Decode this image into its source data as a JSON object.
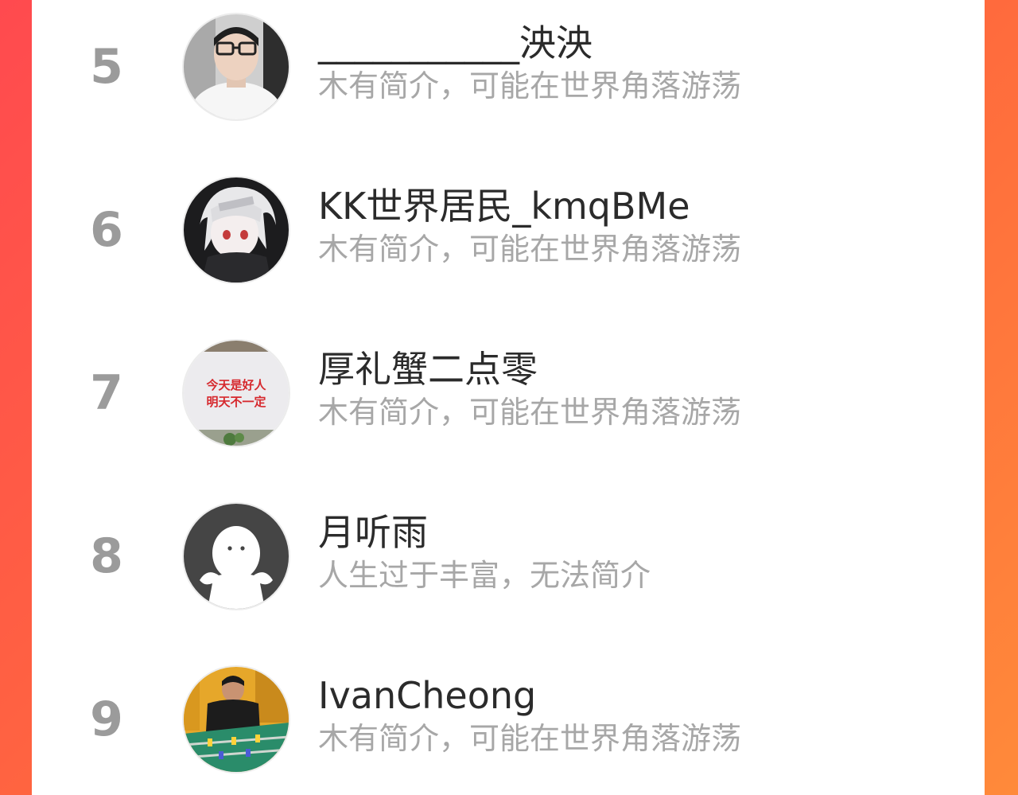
{
  "ranking": {
    "items": [
      {
        "rank": "5",
        "name": "___________泱泱",
        "bio": "木有简介，可能在世界角落游荡",
        "avatar_icon": "user-photo-glasses"
      },
      {
        "rank": "6",
        "name": "KK世界居民_kmqBMe",
        "bio": "木有简介，可能在世界角落游荡",
        "avatar_icon": "anime-character-avatar"
      },
      {
        "rank": "7",
        "name": "厚礼蟹二点零",
        "bio": "木有简介，可能在世界角落游荡",
        "avatar_icon": "wall-slogan-avatar",
        "avatar_text_line1": "今天是好人",
        "avatar_text_line2": "明天不一定"
      },
      {
        "rank": "8",
        "name": "月听雨",
        "bio": "人生过于丰富，无法简介",
        "avatar_icon": "default-user-avatar"
      },
      {
        "rank": "9",
        "name": "IvanCheong",
        "bio": "木有简介，可能在世界角落游荡",
        "avatar_icon": "foosball-photo-avatar"
      }
    ]
  },
  "colors": {
    "background_start": "#ff4a4f",
    "background_end": "#ff8a3a",
    "card": "#ffffff",
    "rank_text": "#9b9b9b",
    "name_text": "#2b2b2b",
    "bio_text": "#a7a7a7"
  }
}
